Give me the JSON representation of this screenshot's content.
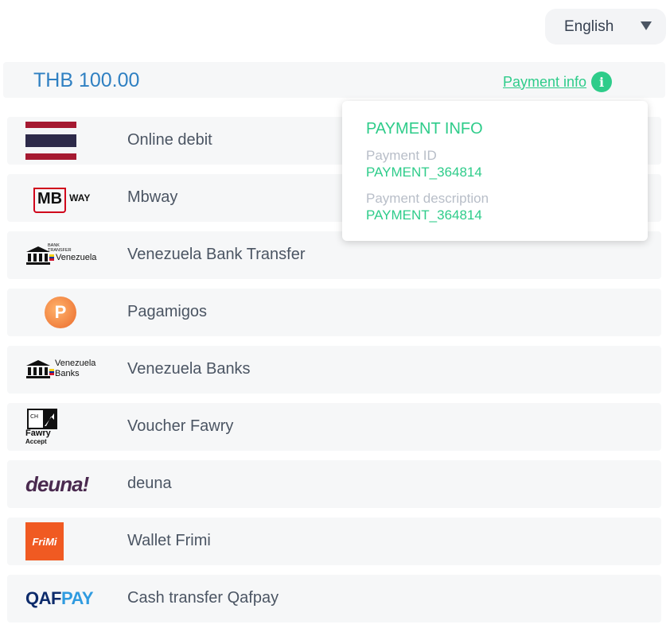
{
  "language": {
    "selected": "English"
  },
  "header": {
    "amount": "THB 100.00",
    "payment_info_link": "Payment info"
  },
  "popover": {
    "title": "PAYMENT INFO",
    "payment_id_label": "Payment ID",
    "payment_id_value": "PAYMENT_364814",
    "payment_description_label": "Payment description",
    "payment_description_value": "PAYMENT_364814"
  },
  "methods": [
    {
      "name": "Online debit",
      "logo": "thailand-flag-icon"
    },
    {
      "name": "Mbway",
      "logo": "mbway-logo",
      "logo_text_a": "MB",
      "logo_text_b": "WAY"
    },
    {
      "name": "Venezuela Bank Transfer",
      "logo": "bank-transfer-logo",
      "logo_text_a": "BANK TRANSFER",
      "logo_text_b": "Venezuela"
    },
    {
      "name": "Pagamigos",
      "logo": "pagamigos-logo"
    },
    {
      "name": "Venezuela Banks",
      "logo": "venezuela-banks-logo",
      "logo_text_a": "Venezuela",
      "logo_text_b": "Banks"
    },
    {
      "name": "Voucher Fawry",
      "logo": "fawry-logo",
      "logo_text_a": "Fawry",
      "logo_text_b": "Accept"
    },
    {
      "name": "deuna",
      "logo": "deuna-logo",
      "logo_text_a": "deuna!"
    },
    {
      "name": "Wallet Frimi",
      "logo": "frimi-logo",
      "logo_text_a": "FriMi"
    },
    {
      "name": "Cash transfer Qafpay",
      "logo": "qafpay-logo",
      "logo_text_a": "QAF",
      "logo_text_b": "PAY"
    }
  ],
  "colors": {
    "accent_green": "#2ecc8a",
    "amount_blue": "#2f80c2",
    "row_bg": "#f6f7f8"
  }
}
